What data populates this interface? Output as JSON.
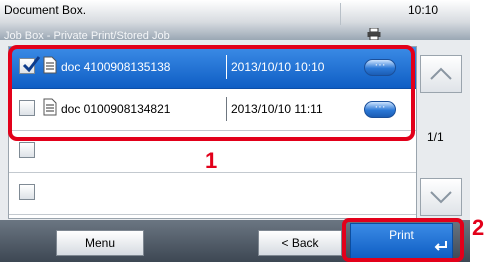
{
  "header": {
    "title": "Document Box.",
    "subtitle": "Job Box - Private Print/Stored Job",
    "clock": "10:10",
    "icon": "printer-icon"
  },
  "list": {
    "rows": [
      {
        "checked": true,
        "name": "doc 4100908135138",
        "date": "2013/10/10 10:10",
        "more_label": "···",
        "selected": true
      },
      {
        "checked": false,
        "name": "doc 0100908134821",
        "date": "2013/10/10 11:11",
        "more_label": "···",
        "selected": false
      },
      {
        "checked": false,
        "name": "",
        "date": "",
        "selected": false
      },
      {
        "checked": false,
        "name": "",
        "date": "",
        "selected": false
      }
    ]
  },
  "pagination": {
    "page_indicator": "1/1"
  },
  "footer": {
    "menu_label": "Menu",
    "back_label": "< Back",
    "print_label": "Print"
  },
  "callouts": {
    "list_number": "1",
    "print_number": "2"
  },
  "colors": {
    "selection_blue": "#1f6fd8",
    "highlight_red": "#e2001a"
  }
}
